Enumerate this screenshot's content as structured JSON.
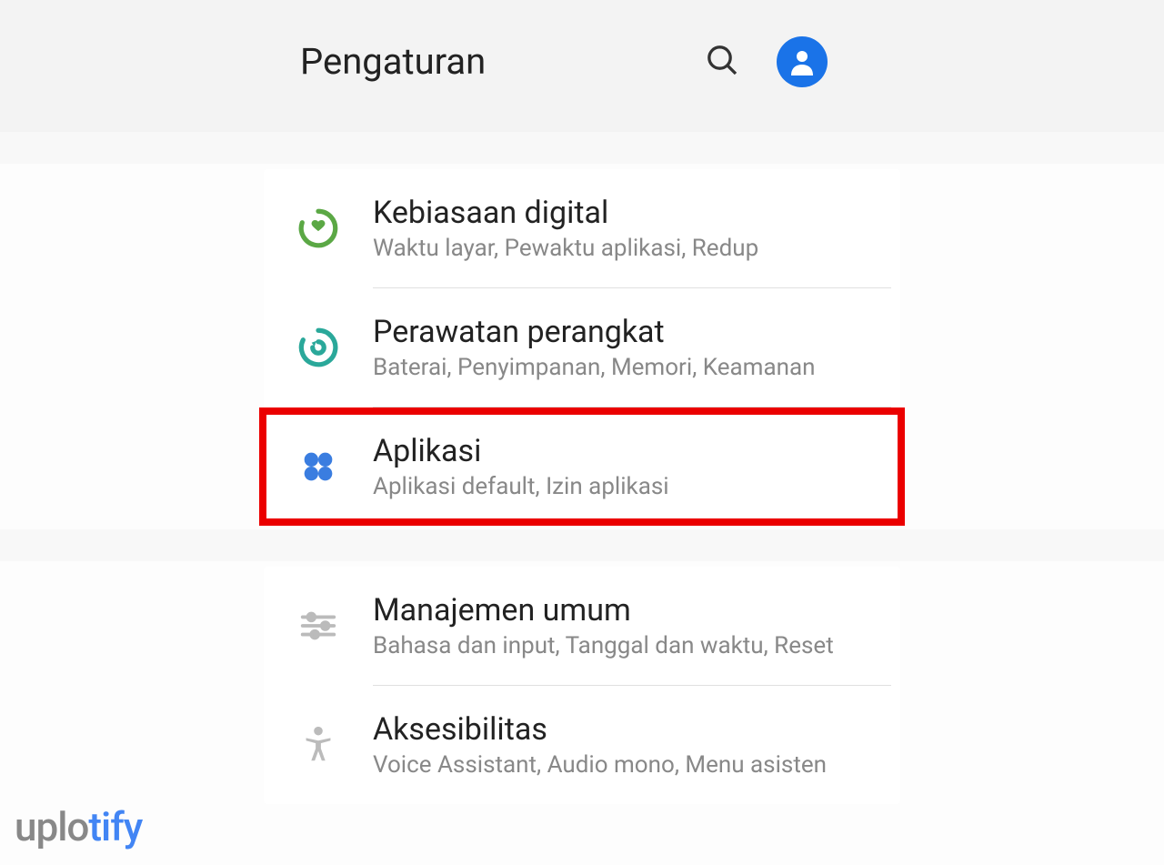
{
  "header": {
    "title": "Pengaturan"
  },
  "items": [
    {
      "title": "Kebiasaan digital",
      "subtitle": "Waktu layar, Pewaktu aplikasi, Redup"
    },
    {
      "title": "Perawatan perangkat",
      "subtitle": "Baterai, Penyimpanan, Memori, Keamanan"
    },
    {
      "title": "Aplikasi",
      "subtitle": "Aplikasi default, Izin aplikasi"
    },
    {
      "title": "Manajemen umum",
      "subtitle": "Bahasa dan input, Tanggal dan waktu, Reset"
    },
    {
      "title": "Aksesibilitas",
      "subtitle": "Voice Assistant, Audio mono, Menu asisten"
    }
  ],
  "watermark": {
    "part1": "uplo",
    "part2": "tify"
  }
}
